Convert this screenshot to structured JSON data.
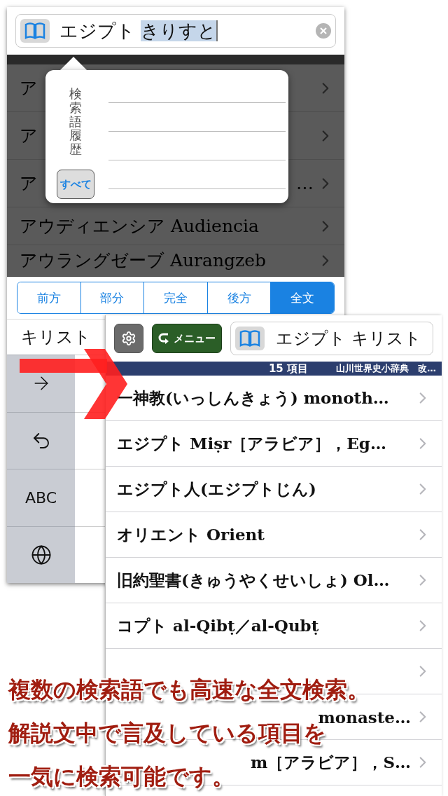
{
  "search_field": {
    "value": "エジプト ",
    "selected_text": "きりすと"
  },
  "background_rows": [
    {
      "text": "ア"
    },
    {
      "text": "ア"
    },
    {
      "text": "ア",
      "tail": "…"
    },
    {
      "text": "アウディエンシア Audiencia"
    },
    {
      "text": "アウラングゼーブ Aurangzeb"
    }
  ],
  "history_popover": {
    "title": "検索語履歴",
    "all_button": "すべて"
  },
  "match_modes": [
    {
      "label": "前方",
      "selected": false
    },
    {
      "label": "部分",
      "selected": false
    },
    {
      "label": "完全",
      "selected": false
    },
    {
      "label": "後方",
      "selected": false
    },
    {
      "label": "全文",
      "selected": true
    }
  ],
  "candidate": "キリスト",
  "keyboard_keys": [
    {
      "kind": "arrow"
    },
    {
      "kind": "undo"
    },
    {
      "kind": "text",
      "label": "ABC"
    },
    {
      "kind": "globe"
    }
  ],
  "front_screen": {
    "menu_button": "メニュー",
    "search_value": "エジプト キリスト",
    "count": "15 項目",
    "dictionary": "山川世界史小辞典　改…",
    "rows": [
      {
        "kind": "full",
        "text": "一神教(いっしんきょう) monoth…"
      },
      {
        "kind": "full",
        "text": "エジプト Miṣr［アラビア］，Eg…"
      },
      {
        "kind": "full",
        "text": "エジプト人(エジプトじん)"
      },
      {
        "kind": "full",
        "text": "オリエント Orient"
      },
      {
        "kind": "full",
        "text": "旧約聖書(きゅうやくせいしょ) Ol…"
      },
      {
        "kind": "full",
        "text": "コプト al-Qibṭ／al-Qubṭ"
      },
      {
        "kind": "covered"
      },
      {
        "kind": "partial",
        "text": "monaste…"
      },
      {
        "kind": "partial",
        "text": "m［アラビア］，S…"
      }
    ]
  },
  "caption": [
    "複数の検索語でも高速な全文検索。",
    "解説文中で言及している項目を",
    "一気に検索可能です。"
  ]
}
